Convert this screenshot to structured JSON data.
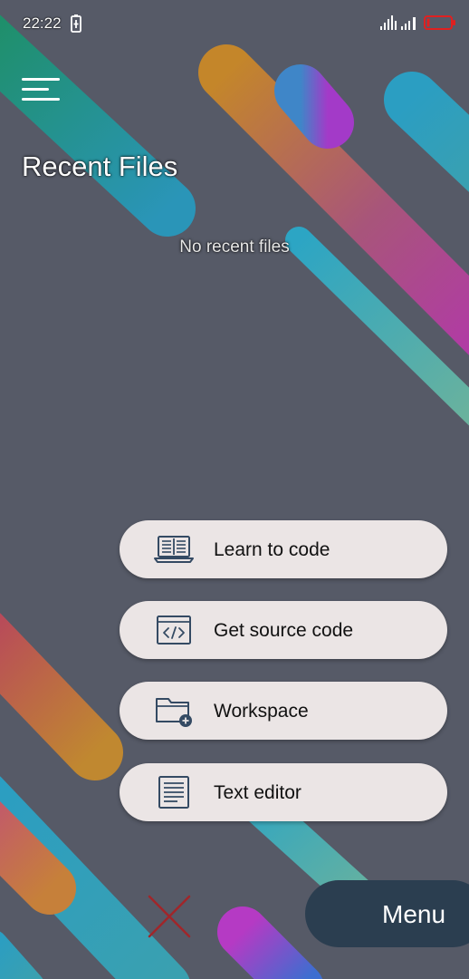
{
  "status": {
    "time": "22:22",
    "icons": [
      "battery-charging-icon",
      "signal-icon",
      "signal-icon",
      "battery-icon"
    ]
  },
  "header": {
    "menu_icon": "hamburger-menu-icon",
    "title": "Recent Files"
  },
  "recent": {
    "empty_message": "No recent files"
  },
  "actions": [
    {
      "label": "Learn to code",
      "icon": "laptop-book-icon"
    },
    {
      "label": "Get source code",
      "icon": "code-window-icon"
    },
    {
      "label": "Workspace",
      "icon": "folder-add-icon"
    },
    {
      "label": "Text editor",
      "icon": "document-text-icon"
    }
  ],
  "footer": {
    "close_icon": "close-icon",
    "menu_label": "Menu"
  },
  "colors": {
    "background": "#565a67",
    "button_bg": "#ebe5e5",
    "menu_bg": "#2b3e50",
    "close_red": "#a0262a",
    "icon_navy": "#344a63"
  }
}
